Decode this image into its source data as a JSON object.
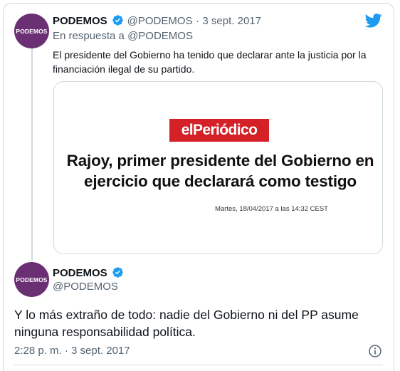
{
  "tweet1": {
    "avatar_text": "PODEMOS",
    "name": "PODEMOS",
    "handle": "@PODEMOS",
    "dot": "·",
    "date": "3 sept. 2017",
    "reply_to": "En respuesta a @PODEMOS",
    "text": "El presidente del Gobierno ha tenido que declarar ante la justicia por la financiación ilegal de su partido.",
    "card": {
      "logo_text": "elPeriódico",
      "headline": "Rajoy, primer presidente del Gobierno en ejercicio que declarará como testigo",
      "dateline": "Martes, 18/04/2017 a las 14:32 CEST"
    }
  },
  "tweet2": {
    "avatar_text": "PODEMOS",
    "name": "PODEMOS",
    "handle": "@PODEMOS",
    "text": "Y lo más extraño de todo: nadie del Gobierno ni del PP asume ninguna responsabilidad política.",
    "timestamp": "2:28 p. m. · 3 sept. 2017"
  },
  "colors": {
    "avatar_bg": "#6b2f73",
    "verified": "#1d9bf0",
    "twitter_blue": "#1d9bf0",
    "periodico_red": "#d42027"
  },
  "icons": [
    "verified-badge-icon",
    "twitter-bird-icon",
    "info-icon"
  ]
}
